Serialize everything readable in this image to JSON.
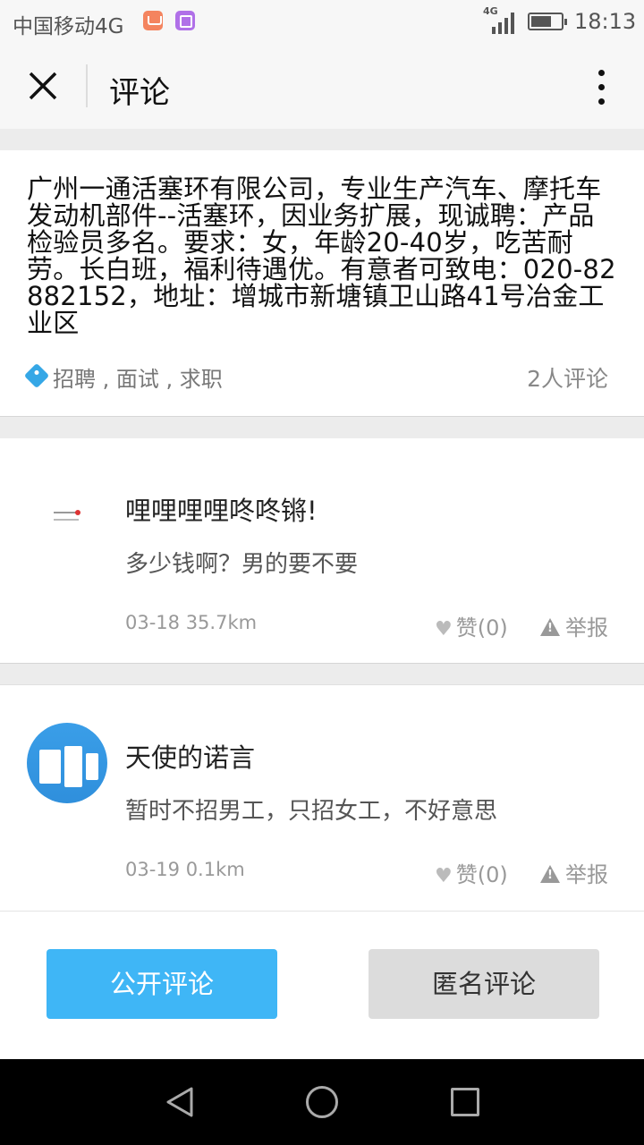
{
  "status_bar": {
    "carrier": "中国移动4G",
    "network_label": "4G",
    "time": "18:13"
  },
  "nav": {
    "title": "评论"
  },
  "post": {
    "text": "广州一通活塞环有限公司，专业生产汽车、摩托车发动机部件--活塞环，因业务扩展，现诚聘：产品检验员多名。要求：女，年龄20-40岁，吃苦耐劳。长白班，福利待遇优。有意者可致电：020-82882152，地址：增城市新塘镇卫山路41号冶金工业区",
    "tags": "招聘 , 面试 , 求职",
    "comment_count": "2人评论"
  },
  "comments": [
    {
      "name": "哩哩哩哩咚咚锵!",
      "body": "多少钱啊？男的要不要",
      "meta": "03-18  35.7km",
      "like_label": "赞(0)",
      "report_label": "举报"
    },
    {
      "name": "天使的诺言",
      "body": "暂时不招男工，只招女工，不好意思",
      "meta": "03-19  0.1km",
      "like_label": "赞(0)",
      "report_label": "举报"
    }
  ],
  "buttons": {
    "public_comment": "公开评论",
    "anonymous_comment": "匿名评论"
  },
  "colors": {
    "accent": "#3fb6f6",
    "tag_icon": "#35a7e6"
  }
}
